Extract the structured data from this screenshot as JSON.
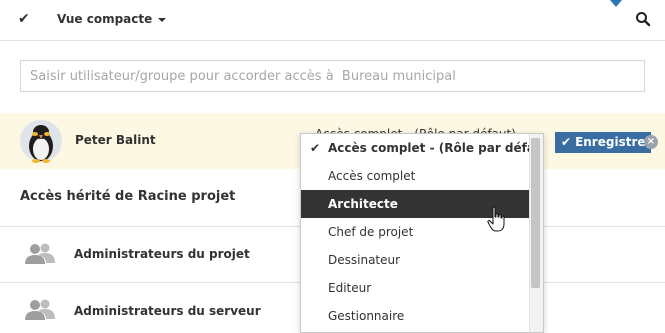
{
  "toolbar": {
    "check_icon": "checkmark-icon",
    "view_label": "Vue compacte",
    "search_icon": "search-icon"
  },
  "search": {
    "placeholder": "Saisir utilisateur/groupe pour accorder accès à  Bureau municipal"
  },
  "user_row": {
    "avatar_icon": "penguin-avatar",
    "name": "Peter Balint",
    "role_selected": "Accès complet - (Rôle par défaut)",
    "save_label": "Enregistrer",
    "close_label": "×"
  },
  "inherited": {
    "title": "Accès hérité de Racine projet",
    "groups": [
      {
        "label": "Administrateurs du projet",
        "icon": "user-group-icon"
      },
      {
        "label": "Administrateurs du serveur",
        "icon": "user-group-icon"
      }
    ]
  },
  "role_dropdown": {
    "items": [
      {
        "label": "Accès complet - (Rôle par défaut)",
        "state": "current"
      },
      {
        "label": "Accès complet",
        "state": ""
      },
      {
        "label": "Architecte",
        "state": "highlighted"
      },
      {
        "label": "Chef de projet",
        "state": ""
      },
      {
        "label": "Dessinateur",
        "state": ""
      },
      {
        "label": "Editeur",
        "state": ""
      },
      {
        "label": "Gestionnaire",
        "state": ""
      }
    ]
  },
  "colors": {
    "row_highlight": "#fcf8e3",
    "primary_button": "#3a6ea2",
    "menu_highlight": "#333333",
    "accent_notch": "#2b76b5"
  }
}
